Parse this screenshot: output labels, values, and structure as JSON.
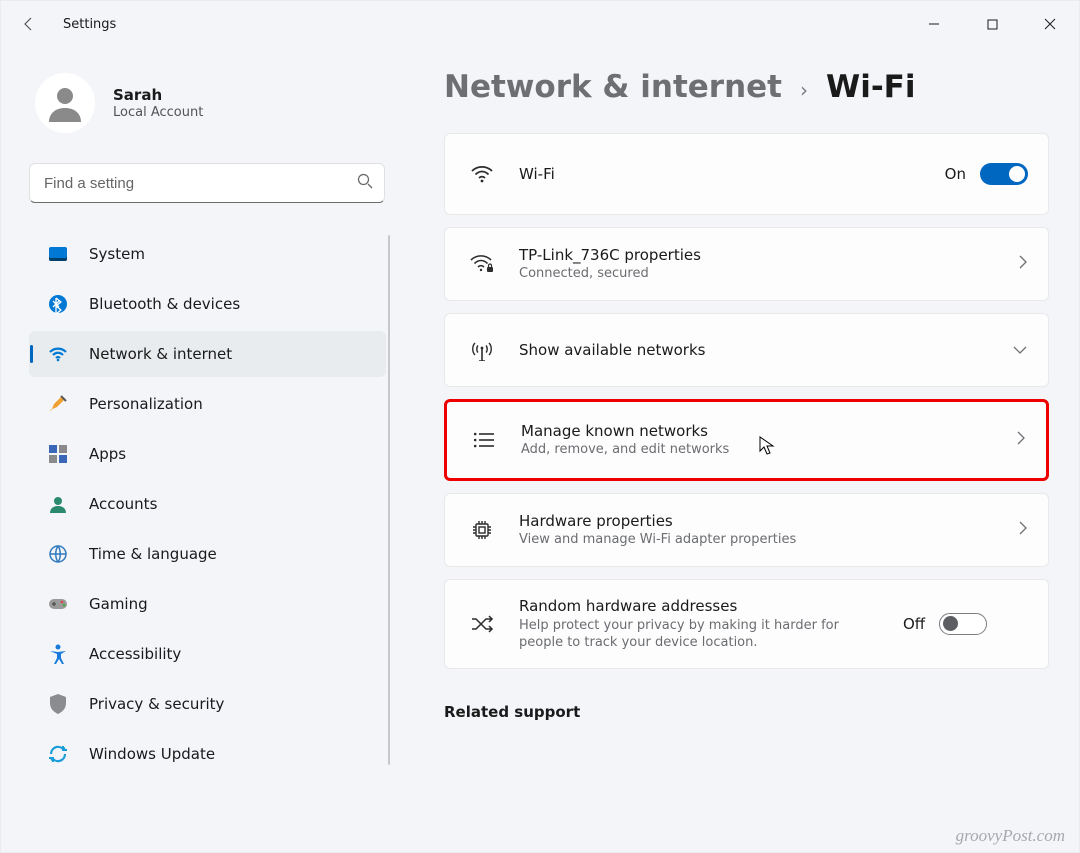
{
  "window": {
    "title": "Settings"
  },
  "profile": {
    "name": "Sarah",
    "sub": "Local Account"
  },
  "search": {
    "placeholder": "Find a setting"
  },
  "sidebar": {
    "items": [
      {
        "label": "System"
      },
      {
        "label": "Bluetooth & devices"
      },
      {
        "label": "Network & internet"
      },
      {
        "label": "Personalization"
      },
      {
        "label": "Apps"
      },
      {
        "label": "Accounts"
      },
      {
        "label": "Time & language"
      },
      {
        "label": "Gaming"
      },
      {
        "label": "Accessibility"
      },
      {
        "label": "Privacy & security"
      },
      {
        "label": "Windows Update"
      }
    ]
  },
  "breadcrumb": {
    "parent": "Network & internet",
    "sep": "›",
    "leaf": "Wi-Fi"
  },
  "cards": {
    "wifi": {
      "label": "Wi-Fi",
      "state_text": "On",
      "state": true
    },
    "conn": {
      "label": "TP-Link_736C properties",
      "sub": "Connected, secured"
    },
    "avail": {
      "label": "Show available networks"
    },
    "known": {
      "label": "Manage known networks",
      "sub": "Add, remove, and edit networks"
    },
    "hw": {
      "label": "Hardware properties",
      "sub": "View and manage Wi-Fi adapter properties"
    },
    "rand": {
      "label": "Random hardware addresses",
      "sub": "Help protect your privacy by making it harder for people to track your device location.",
      "state_text": "Off",
      "state": false
    }
  },
  "section": {
    "related": "Related support"
  },
  "watermark": "groovyPost.com",
  "colors": {
    "accent": "#0067c0",
    "highlight": "#ee0000"
  }
}
